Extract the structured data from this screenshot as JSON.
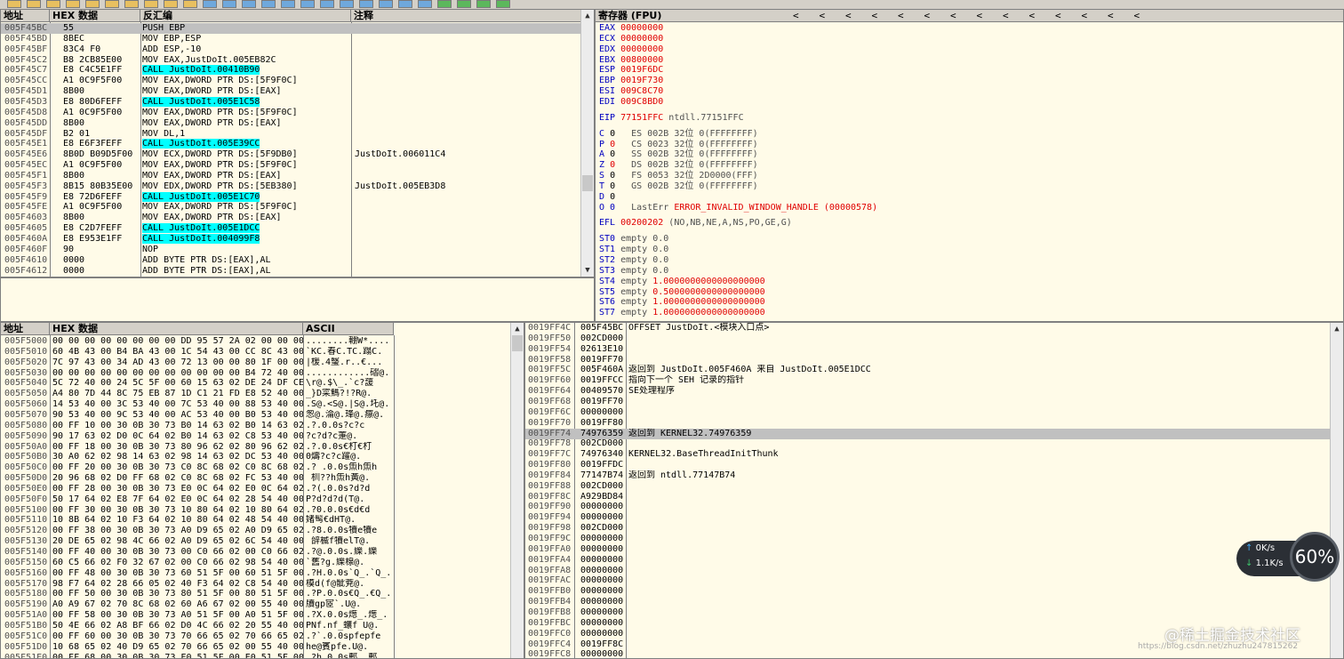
{
  "toolbar": {
    "icons": [
      "open-icon",
      "restart-icon",
      "close-icon",
      "run-icon",
      "pause-icon",
      "step-into-icon",
      "step-over-icon",
      "trace-into-icon",
      "trace-over-icon",
      "execute-till-return-icon",
      "goto-icon",
      "log-icon",
      "modules-icon",
      "memory-icon",
      "threads-icon",
      "windows-icon",
      "handles-icon",
      "cpu-icon",
      "patches-icon",
      "callstack-icon",
      "breakpoints-icon",
      "references-icon",
      "runtrace-icon",
      "source-icon",
      "options-icon",
      "help-icon"
    ]
  },
  "disasm": {
    "headers": {
      "addr": "地址",
      "hex": "HEX 数据",
      "asm": "反汇编",
      "comment": "注释"
    },
    "rows": [
      {
        "addr": "005F45BC",
        "hex": "55",
        "asm": "PUSH EBP",
        "comment": "",
        "sel": true
      },
      {
        "addr": "005F45BD",
        "hex": "8BEC",
        "asm": "MOV EBP,ESP",
        "comment": ""
      },
      {
        "addr": "005F45BF",
        "hex": "83C4 F0",
        "asm": "ADD ESP,-10",
        "comment": ""
      },
      {
        "addr": "005F45C2",
        "hex": "B8 2CB85E00",
        "asm": "MOV EAX,JustDoIt.005EB82C",
        "comment": ""
      },
      {
        "addr": "005F45C7",
        "hex": "E8 C4C5E1FF",
        "asm": "CALL JustDoIt.00410B90",
        "comment": "",
        "call": true
      },
      {
        "addr": "005F45CC",
        "hex": "A1 0C9F5F00",
        "asm": "MOV EAX,DWORD PTR DS:[5F9F0C]",
        "comment": ""
      },
      {
        "addr": "005F45D1",
        "hex": "8B00",
        "asm": "MOV EAX,DWORD PTR DS:[EAX]",
        "comment": ""
      },
      {
        "addr": "005F45D3",
        "hex": "E8 80D6FEFF",
        "asm": "CALL JustDoIt.005E1C58",
        "comment": "",
        "call": true
      },
      {
        "addr": "005F45D8",
        "hex": "A1 0C9F5F00",
        "asm": "MOV EAX,DWORD PTR DS:[5F9F0C]",
        "comment": ""
      },
      {
        "addr": "005F45DD",
        "hex": "8B00",
        "asm": "MOV EAX,DWORD PTR DS:[EAX]",
        "comment": ""
      },
      {
        "addr": "005F45DF",
        "hex": "B2 01",
        "asm": "MOV DL,1",
        "comment": ""
      },
      {
        "addr": "005F45E1",
        "hex": "E8 E6F3FEFF",
        "asm": "CALL JustDoIt.005E39CC",
        "comment": "",
        "call": true
      },
      {
        "addr": "005F45E6",
        "hex": "8B0D B09D5F00",
        "asm": "MOV ECX,DWORD PTR DS:[5F9DB0]",
        "comment": "JustDoIt.006011C4"
      },
      {
        "addr": "005F45EC",
        "hex": "A1 0C9F5F00",
        "asm": "MOV EAX,DWORD PTR DS:[5F9F0C]",
        "comment": ""
      },
      {
        "addr": "005F45F1",
        "hex": "8B00",
        "asm": "MOV EAX,DWORD PTR DS:[EAX]",
        "comment": ""
      },
      {
        "addr": "005F45F3",
        "hex": "8B15 80B35E00",
        "asm": "MOV EDX,DWORD PTR DS:[5EB380]",
        "comment": "JustDoIt.005EB3D8"
      },
      {
        "addr": "005F45F9",
        "hex": "E8 72D6FEFF",
        "asm": "CALL JustDoIt.005E1C70",
        "comment": "",
        "call": true
      },
      {
        "addr": "005F45FE",
        "hex": "A1 0C9F5F00",
        "asm": "MOV EAX,DWORD PTR DS:[5F9F0C]",
        "comment": ""
      },
      {
        "addr": "005F4603",
        "hex": "8B00",
        "asm": "MOV EAX,DWORD PTR DS:[EAX]",
        "comment": ""
      },
      {
        "addr": "005F4605",
        "hex": "E8 C2D7FEFF",
        "asm": "CALL JustDoIt.005E1DCC",
        "comment": "",
        "call": true
      },
      {
        "addr": "005F460A",
        "hex": "E8 E953E1FF",
        "asm": "CALL JustDoIt.004099F8",
        "comment": "",
        "call": true
      },
      {
        "addr": "005F460F",
        "hex": "90",
        "asm": "NOP",
        "comment": ""
      },
      {
        "addr": "005F4610",
        "hex": "0000",
        "asm": "ADD BYTE PTR DS:[EAX],AL",
        "comment": ""
      },
      {
        "addr": "005F4612",
        "hex": "0000",
        "asm": "ADD BYTE PTR DS:[EAX],AL",
        "comment": ""
      }
    ]
  },
  "registers": {
    "header": "寄存器 (FPU)",
    "arrows": [
      "<",
      "<",
      "<",
      "<",
      "<",
      "<",
      "<",
      "<",
      "<",
      "<",
      "<",
      "<",
      "<",
      "<"
    ],
    "gp": [
      {
        "name": "EAX",
        "val": "00000000"
      },
      {
        "name": "ECX",
        "val": "00000000"
      },
      {
        "name": "EDX",
        "val": "00000000"
      },
      {
        "name": "EBX",
        "val": "00800000"
      },
      {
        "name": "ESP",
        "val": "0019F6DC"
      },
      {
        "name": "EBP",
        "val": "0019F730"
      },
      {
        "name": "ESI",
        "val": "009C8C70"
      },
      {
        "name": "EDI",
        "val": "009C8BD0"
      }
    ],
    "eip": {
      "name": "EIP",
      "val": "77151FFC",
      "desc": "ntdll.77151FFC"
    },
    "flags": [
      {
        "f": "C",
        "v": "0",
        "seg": "ES 002B",
        "bits": "32位",
        "base": "0(FFFFFFFF)"
      },
      {
        "f": "P",
        "v": "0",
        "seg": "CS 0023",
        "bits": "32位",
        "base": "0(FFFFFFFF)"
      },
      {
        "f": "A",
        "v": "0",
        "seg": "SS 002B",
        "bits": "32位",
        "base": "0(FFFFFFFF)"
      },
      {
        "f": "Z",
        "v": "0",
        "seg": "DS 002B",
        "bits": "32位",
        "base": "0(FFFFFFFF)"
      },
      {
        "f": "S",
        "v": "0",
        "seg": "FS 0053",
        "bits": "32位",
        "base": "2D0000(FFF)"
      },
      {
        "f": "T",
        "v": "0",
        "seg": "GS 002B",
        "bits": "32位",
        "base": "0(FFFFFFFF)"
      },
      {
        "f": "D",
        "v": "0",
        "seg": "",
        "bits": "",
        "base": ""
      }
    ],
    "lasterr": {
      "prefix": "O 0",
      "label": "LastErr",
      "val": "ERROR_INVALID_WINDOW_HANDLE (00000578)"
    },
    "efl": {
      "label": "EFL",
      "val": "00200202",
      "desc": "(NO,NB,NE,A,NS,PO,GE,G)"
    },
    "fpu": [
      {
        "name": "ST0",
        "tag": "empty",
        "val": "0.0"
      },
      {
        "name": "ST1",
        "tag": "empty",
        "val": "0.0"
      },
      {
        "name": "ST2",
        "tag": "empty",
        "val": "0.0"
      },
      {
        "name": "ST3",
        "tag": "empty",
        "val": "0.0"
      },
      {
        "name": "ST4",
        "tag": "empty",
        "val": "1.0000000000000000000"
      },
      {
        "name": "ST5",
        "tag": "empty",
        "val": "0.5000000000000000000"
      },
      {
        "name": "ST6",
        "tag": "empty",
        "val": "1.0000000000000000000"
      },
      {
        "name": "ST7",
        "tag": "empty",
        "val": "1.0000000000000000000"
      }
    ]
  },
  "dump": {
    "headers": {
      "addr": "地址",
      "hex": "HEX 数据",
      "ascii": "ASCII"
    },
    "rows": [
      {
        "addr": "005F5000",
        "hex": "00 00 00 00 00 00 00 00 DD 95 57 2A 02 00 00 00",
        "ascii": "........輣W*...."
      },
      {
        "addr": "005F5010",
        "hex": "60 4B 43 00 B4 BA 43 00 1C 54 43 00 CC 8C 43 00",
        "ascii": "`KC.春C.TC.蹋C."
      },
      {
        "addr": "005F5020",
        "hex": "7C 97 43 00 34 AD 43 00 72 13 00 00 80 1F 00 00",
        "ascii": "|楥.4瑿.r..€..."
      },
      {
        "addr": "005F5030",
        "hex": "00 00 00 00 00 00 00 00 00 00 00 00 B4 72 40 00",
        "ascii": "............磖@."
      },
      {
        "addr": "005F5040",
        "hex": "5C 72 40 00 24 5C 5F 00 60 15 63 02 DE 24 DF CE",
        "ascii": "\\r@.$\\_.`c?蘐"
      },
      {
        "addr": "005F5050",
        "hex": "A4 80 7D 44 8C 75 EB 87 1D C1 21 FD E8 52 40 00",
        "ascii": "_}D寀鰢?!?R@."
      },
      {
        "addr": "005F5060",
        "hex": "14 53 40 00 3C 53 40 00 7C 53 40 00 88 53 40 00",
        "ascii": ".S@.<S@.|S@.圫@."
      },
      {
        "addr": "005F5070",
        "hex": "90 53 40 00 9C 53 40 00 AC 53 40 00 B0 53 40 00",
        "ascii": "怱@.淪@.琒@.癝@."
      },
      {
        "addr": "005F5080",
        "hex": "00 FF 10 00 30 0B 30 73 B0 14 63 02 B0 14 63 02",
        "ascii": ".?.0.0s?c?c"
      },
      {
        "addr": "005F5090",
        "hex": "90 17 63 02 D0 0C 64 02 B0 14 63 02 C8 53 40 00",
        "ascii": "?c?d?c萐@."
      },
      {
        "addr": "005F50A0",
        "hex": "00 FF 18 00 30 0B 30 73 80 96 62 02 80 96 62 02",
        "ascii": ".?.0.0s€朾€朾"
      },
      {
        "addr": "005F50B0",
        "hex": "30 A0 62 02 98 14 63 02 98 14 63 02 DC 53 40 00",
        "ascii": "0燽?c?c躍@."
      },
      {
        "addr": "005F50C0",
        "hex": "00 FF 20 00 30 0B 30 73 C0 8C 68 02 C0 8C 68 02",
        "ascii": ".? .0.0s缹h缹h"
      },
      {
        "addr": "005F50D0",
        "hex": "20 96 68 02 D0 FF 68 02 C0 8C 68 02 FC 53 40 00",
        "ascii": " 杊??h缹h黃@."
      },
      {
        "addr": "005F50E0",
        "hex": "00 FF 28 00 30 0B 30 73 E0 0C 64 02 E0 0C 64 02",
        "ascii": ".?(.0.0s?d?d"
      },
      {
        "addr": "005F50F0",
        "hex": "50 17 64 02 E8 7F 64 02 E0 0C 64 02 28 54 40 00",
        "ascii": "P?d?d?d(T@."
      },
      {
        "addr": "005F5100",
        "hex": "00 FF 30 00 30 0B 30 73 10 80 64 02 10 80 64 02",
        "ascii": ".?0.0.0s€d€d"
      },
      {
        "addr": "005F5110",
        "hex": "10 8B 64 02 10 F3 64 02 10 80 64 02 48 54 40 00",
        "ascii": "媎髩€dHT@."
      },
      {
        "addr": "005F5120",
        "hex": "00 FF 38 00 30 0B 30 73 A0 D9 65 02 A0 D9 65 02",
        "ascii": ".?8.0.0s犢e犢e"
      },
      {
        "addr": "005F5130",
        "hex": "20 DE 65 02 98 4C 66 02 A0 D9 65 02 6C 54 40 00",
        "ascii": " 辝楲f犢elT@."
      },
      {
        "addr": "005F5140",
        "hex": "00 FF 40 00 30 0B 30 73 00 C0 66 02 00 C0 66 02",
        "ascii": ".?@.0.0s.纅.纅"
      },
      {
        "addr": "005F5150",
        "hex": "60 C5 66 02 F0 32 67 02 00 C0 66 02 98 54 40 00",
        "ascii": "`舊?g.纅楾@."
      },
      {
        "addr": "005F5160",
        "hex": "00 FF 48 00 30 0B 30 73 60 51 5F 00 60 51 5F 00",
        "ascii": ".?H.0.0s`Q_.`Q_."
      },
      {
        "addr": "005F5170",
        "hex": "98 F7 64 02 28 66 05 02 40 F3 64 02 C8 54 40 00",
        "ascii": "橂d(f@骴萒@."
      },
      {
        "addr": "005F5180",
        "hex": "00 FF 50 00 30 0B 30 73 80 51 5F 00 80 51 5F 00",
        "ascii": ".?P.0.0s€Q_.€Q_."
      },
      {
        "addr": "005F5190",
        "hex": "A0 A9 67 02 70 8C 68 02 60 A6 67 02 00 55 40 00",
        "ascii": "牘gp宧`.U@."
      },
      {
        "addr": "005F51A0",
        "hex": "00 FF 58 00 30 0B 30 73 A0 51 5F 00 A0 51 5F 00",
        "ascii": ".?X.0.0s燪_.燪_."
      },
      {
        "addr": "005F51B0",
        "hex": "50 4E 66 02 A8 BF 66 02 D0 4C 66 02 20 55 40 00",
        "ascii": "PNf.nf_蠰f U@."
      },
      {
        "addr": "005F51C0",
        "hex": "00 FF 60 00 30 0B 30 73 70 66 65 02 70 66 65 02",
        "ascii": ".?`.0.0spfepfe"
      },
      {
        "addr": "005F51D0",
        "hex": "10 68 65 02 40 D9 65 02 70 66 65 02 00 55 40 00",
        "ascii": "he@賓pfe.U@."
      },
      {
        "addr": "005F51E0",
        "hex": "00 FF 68 00 30 0B 30 73 E0 51 5F 00 E0 51 5F 00",
        "ascii": ".?h.0.0s郠_.郠_."
      }
    ]
  },
  "stack": {
    "rows": [
      {
        "addr": "0019FF4C",
        "val": "005F45BC",
        "comment": "OFFSET JustDoIt.<模块入口点>"
      },
      {
        "addr": "0019FF50",
        "val": "002CD000",
        "comment": ""
      },
      {
        "addr": "0019FF54",
        "val": "02613E10",
        "comment": ""
      },
      {
        "addr": "0019FF58",
        "val": "0019FF70",
        "comment": ""
      },
      {
        "addr": "0019FF5C",
        "val": "005F460A",
        "comment": "返回到 JustDoIt.005F460A 来自 JustDoIt.005E1DCC"
      },
      {
        "addr": "0019FF60",
        "val": "0019FFCC",
        "comment": "指向下一个 SEH 记录的指针"
      },
      {
        "addr": "0019FF64",
        "val": "00409570",
        "comment": "SE处理程序"
      },
      {
        "addr": "0019FF68",
        "val": "0019FF70",
        "comment": ""
      },
      {
        "addr": "0019FF6C",
        "val": "00000000",
        "comment": ""
      },
      {
        "addr": "0019FF70",
        "val": "0019FF80",
        "comment": ""
      },
      {
        "addr": "0019FF74",
        "val": "74976359",
        "comment": "返回到 KERNEL32.74976359",
        "sel": true
      },
      {
        "addr": "0019FF78",
        "val": "002CD000",
        "comment": ""
      },
      {
        "addr": "0019FF7C",
        "val": "74976340",
        "comment": "KERNEL32.BaseThreadInitThunk"
      },
      {
        "addr": "0019FF80",
        "val": "0019FFDC",
        "comment": ""
      },
      {
        "addr": "0019FF84",
        "val": "77147B74",
        "comment": "返回到 ntdll.77147B74"
      },
      {
        "addr": "0019FF88",
        "val": "002CD000",
        "comment": ""
      },
      {
        "addr": "0019FF8C",
        "val": "A929BD84",
        "comment": ""
      },
      {
        "addr": "0019FF90",
        "val": "00000000",
        "comment": ""
      },
      {
        "addr": "0019FF94",
        "val": "00000000",
        "comment": ""
      },
      {
        "addr": "0019FF98",
        "val": "002CD000",
        "comment": ""
      },
      {
        "addr": "0019FF9C",
        "val": "00000000",
        "comment": ""
      },
      {
        "addr": "0019FFA0",
        "val": "00000000",
        "comment": ""
      },
      {
        "addr": "0019FFA4",
        "val": "00000000",
        "comment": ""
      },
      {
        "addr": "0019FFA8",
        "val": "00000000",
        "comment": ""
      },
      {
        "addr": "0019FFAC",
        "val": "00000000",
        "comment": ""
      },
      {
        "addr": "0019FFB0",
        "val": "00000000",
        "comment": ""
      },
      {
        "addr": "0019FFB4",
        "val": "00000000",
        "comment": ""
      },
      {
        "addr": "0019FFB8",
        "val": "00000000",
        "comment": ""
      },
      {
        "addr": "0019FFBC",
        "val": "00000000",
        "comment": ""
      },
      {
        "addr": "0019FFC0",
        "val": "00000000",
        "comment": ""
      },
      {
        "addr": "0019FFC4",
        "val": "0019FF8C",
        "comment": ""
      },
      {
        "addr": "0019FFC8",
        "val": "00000000",
        "comment": ""
      }
    ]
  },
  "speed": {
    "up": "0K/s",
    "down": "1.1K/s",
    "percent": "60%"
  },
  "watermark": {
    "text": "@稀土掘金技术社区",
    "sub": "https://blog.csdn.net/zhuzhu247815262"
  }
}
